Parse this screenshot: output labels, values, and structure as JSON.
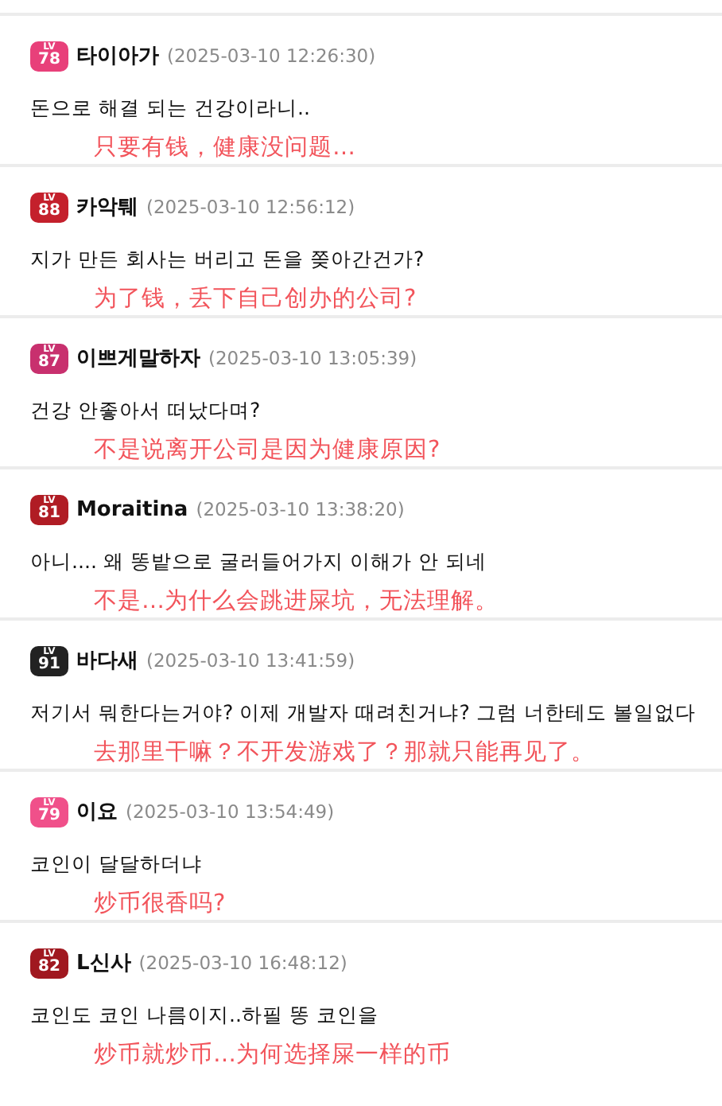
{
  "comments": [
    {
      "badge": {
        "label": "LV",
        "level": "78",
        "color": "#e8407a"
      },
      "user": "타이아가",
      "time": "(2025-03-10 12:26:30)",
      "text": "돈으로 해결 되는 건강이라니..",
      "translation": "只要有钱，健康没问题…"
    },
    {
      "badge": {
        "label": "LV",
        "level": "88",
        "color": "#c4202c"
      },
      "user": "카악퉤",
      "time": "(2025-03-10 12:56:12)",
      "text": "지가 만든 회사는 버리고 돈을 쫒아간건가?",
      "translation": "为了钱，丢下自己创办的公司?"
    },
    {
      "badge": {
        "label": "LV",
        "level": "87",
        "color": "#c8306e"
      },
      "user": "이쁘게말하자",
      "time": "(2025-03-10 13:05:39)",
      "text": "건강 안좋아서 떠났다며?",
      "translation": "不是说离开公司是因为健康原因?"
    },
    {
      "badge": {
        "label": "LV",
        "level": "81",
        "color": "#b01c24"
      },
      "user": "Moraitina",
      "time": "(2025-03-10 13:38:20)",
      "text": "아니.... 왜 똥밭으로 굴러들어가지 이해가 안 되네",
      "translation": "不是…为什么会跳进屎坑，无法理解。"
    },
    {
      "badge": {
        "label": "LV",
        "level": "91",
        "color": "#222222"
      },
      "user": "바다새",
      "time": "(2025-03-10 13:41:59)",
      "text": "저기서 뭐한다는거야? 이제 개발자 때려친거냐? 그럼 너한테도 볼일없다",
      "translation": "去那里干嘛？不开发游戏了？那就只能再见了。"
    },
    {
      "badge": {
        "label": "LV",
        "level": "79",
        "color": "#f0508a"
      },
      "user": "이요",
      "time": "(2025-03-10 13:54:49)",
      "text": "코인이 달달하더냐",
      "translation": "炒币很香吗?"
    },
    {
      "badge": {
        "label": "LV",
        "level": "82",
        "color": "#a01820"
      },
      "user": "L신사",
      "time": "(2025-03-10 16:48:12)",
      "text": "코인도 코인 나름이지..하필 똥 코인을",
      "translation": "炒币就炒币…为何选择屎一样的币"
    }
  ]
}
